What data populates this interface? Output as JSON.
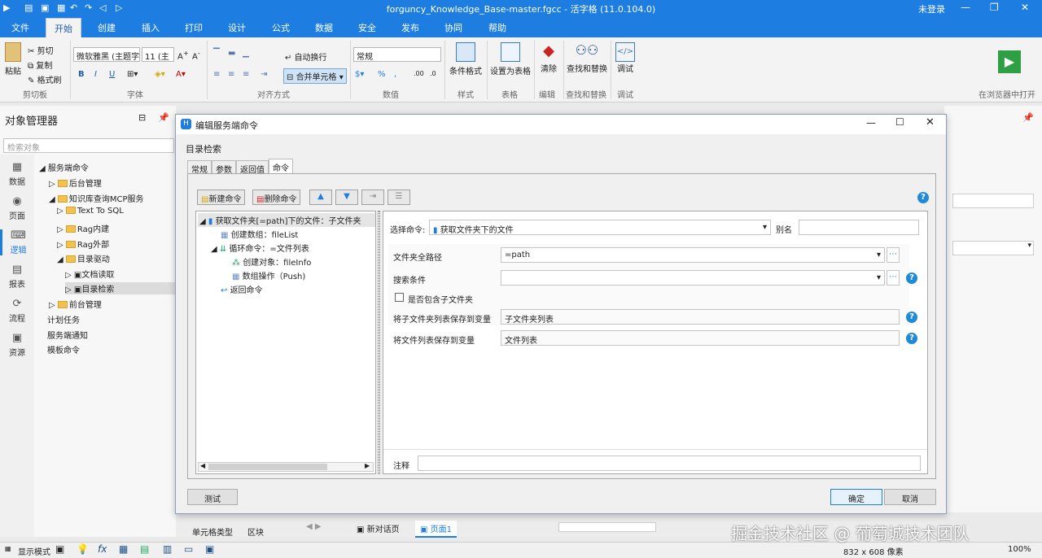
{
  "app": {
    "title": "forguncy_Knowledge_Base-master.fgcc - 活字格 (11.0.104.0)",
    "login": "未登录"
  },
  "ribbon_tabs": [
    "文件",
    "开始",
    "创建",
    "插入",
    "打印",
    "设计",
    "公式",
    "数据",
    "安全",
    "发布",
    "协同",
    "帮助"
  ],
  "ribbon": {
    "paste": "粘贴",
    "cut": "剪切",
    "copy": "复制",
    "format_painter": "格式刷",
    "clipboard_group": "剪切板",
    "font_name": "微软雅黑 (主题字",
    "font_size": "11 (主",
    "bold": "B",
    "italic": "I",
    "underline": "U",
    "font_group": "字体",
    "wrap_text": "自动换行",
    "merge_cells": "合并单元格",
    "align_group": "对齐方式",
    "number_format": "常规",
    "number_group": "数值",
    "cond_format": "条件格式",
    "set_table": "设置为表格",
    "clear": "清除",
    "find_replace": "查找和替换",
    "debug": "调试",
    "style_group": "样式",
    "table_group": "表格",
    "edit_group": "编辑",
    "find_group": "查找和替换",
    "debug_group": "调试",
    "open_browser": "在浏览器中打开"
  },
  "object_manager": {
    "title": "对象管理器",
    "search_placeholder": "检索对象",
    "rail": [
      "数据",
      "页面",
      "逻辑",
      "报表",
      "流程",
      "资源"
    ],
    "tree": [
      {
        "label": "服务端命令"
      },
      {
        "label": "后台管理"
      },
      {
        "label": "知识库查询MCP服务"
      },
      {
        "label": "Text To SQL"
      },
      {
        "label": "Rag内建"
      },
      {
        "label": "Rag外部"
      },
      {
        "label": "目录驱动"
      },
      {
        "label": "文档读取"
      },
      {
        "label": "目录检索"
      },
      {
        "label": "前台管理"
      },
      {
        "label": "计划任务"
      },
      {
        "label": "服务端通知"
      },
      {
        "label": "模板命令"
      }
    ],
    "bottom_tabs": [
      "单元格类型",
      "区块"
    ]
  },
  "dialog": {
    "title": "编辑服务端命令",
    "subtitle": "目录检索",
    "tabs": [
      "常规",
      "参数",
      "返回值",
      "命令"
    ],
    "new_cmd": "新建命令",
    "del_cmd": "删除命令",
    "commands": [
      "获取文件夹[=path]下的文件：子文件夹",
      "创建数组：fileList",
      "循环命令：=文件列表",
      "创建对象：fileInfo",
      "数组操作（Push)",
      "返回命令"
    ],
    "select_cmd_label": "选择命令:",
    "select_cmd_value": "获取文件夹下的文件",
    "alias_label": "别名",
    "alias_value": "",
    "path_label": "文件夹全路径",
    "path_value": "=path",
    "search_label": "搜索条件",
    "search_value": "",
    "include_sub": "是否包含子文件夹",
    "save_sub_label": "将子文件夹列表保存到变量",
    "save_sub_value": "子文件夹列表",
    "save_file_label": "将文件列表保存到变量",
    "save_file_value": "文件列表",
    "note_label": "注释",
    "note_value": "",
    "test": "测试",
    "ok": "确定",
    "cancel": "取消"
  },
  "page_tabs": [
    "新对话页",
    "页面1"
  ],
  "status": {
    "mode": "显示模式",
    "size": "832 x 608 像素",
    "zoom": "100%"
  },
  "watermark": "掘金技术社区 @ 葡萄城技术团队"
}
